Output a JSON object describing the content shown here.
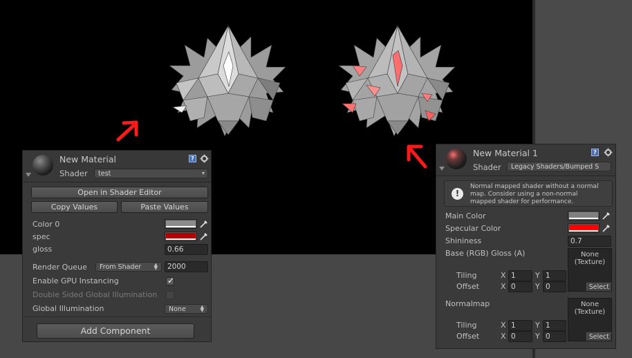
{
  "scene": {
    "colors": {
      "background": "#000000",
      "floor": "#474747",
      "arrow": "#ff1a1a"
    }
  },
  "inspector_left": {
    "title": "New Material",
    "shader_label": "Shader",
    "shader_value": "test",
    "open_shader_editor": "Open in Shader Editor",
    "copy_values": "Copy Values",
    "paste_values": "Paste Values",
    "properties": {
      "color0": {
        "label": "Color 0",
        "color": "#8c8c8c"
      },
      "spec": {
        "label": "spec",
        "color": "#b30000"
      },
      "gloss": {
        "label": "gloss",
        "value": "0.66"
      }
    },
    "render_queue": {
      "label": "Render Queue",
      "mode": "From Shader",
      "value": "2000"
    },
    "gpu_instancing": {
      "label": "Enable GPU Instancing",
      "checked": true
    },
    "double_sided_gi": {
      "label": "Double Sided Global Illumination",
      "checked": false
    },
    "global_illumination": {
      "label": "Global Illumination",
      "value": "None"
    },
    "add_component": "Add Component"
  },
  "inspector_right": {
    "title": "New Material 1",
    "shader_label": "Shader",
    "shader_value": "Legacy Shaders/Bumped S",
    "help_lines": [
      "Normal mapped shader without a normal",
      "map. Consider using a non-normal",
      "mapped shader for performance."
    ],
    "main_color": {
      "label": "Main Color",
      "color": "#808080"
    },
    "specular_color": {
      "label": "Specular Color",
      "color": "#ff0000"
    },
    "shininess": {
      "label": "Shininess",
      "value": "0.7"
    },
    "base_texture": {
      "label": "Base (RGB) Gloss (A)",
      "slot_line1": "None",
      "slot_line2": "(Texture)",
      "select": "Select",
      "tiling_label": "Tiling",
      "offset_label": "Offset",
      "x_label": "X",
      "y_label": "Y",
      "tiling_x": "1",
      "tiling_y": "1",
      "offset_x": "0",
      "offset_y": "0"
    },
    "normalmap": {
      "label": "Normalmap",
      "slot_line1": "None",
      "slot_line2": "(Texture)",
      "select": "Select",
      "tiling_label": "Tiling",
      "offset_label": "Offset",
      "x_label": "X",
      "y_label": "Y",
      "tiling_x": "1",
      "tiling_y": "1",
      "offset_x": "0",
      "offset_y": "0"
    }
  }
}
